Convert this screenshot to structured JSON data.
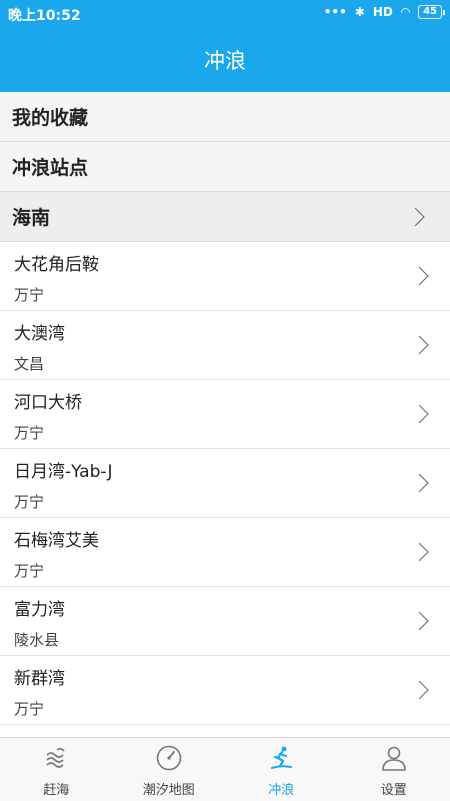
{
  "status_bar": {
    "time": "晚上10:52",
    "dots": "•••",
    "bluetooth": "✱",
    "signal": "HD",
    "wifi": "◠",
    "battery": "45"
  },
  "header": {
    "title": "冲浪"
  },
  "menu": {
    "favorites": "我的收藏",
    "surf_spots": "冲浪站点"
  },
  "region": {
    "name": "海南"
  },
  "spots": [
    {
      "name": "大花角后鞍",
      "location": "万宁"
    },
    {
      "name": "大澳湾",
      "location": "文昌"
    },
    {
      "name": "河口大桥",
      "location": "万宁"
    },
    {
      "name": "日月湾-Yab-J",
      "location": "万宁"
    },
    {
      "name": "石梅湾艾美",
      "location": "万宁"
    },
    {
      "name": "富力湾",
      "location": "陵水县"
    },
    {
      "name": "新群湾",
      "location": "万宁"
    }
  ],
  "tabs": [
    {
      "label": "赶海",
      "icon": "waves-icon",
      "active": false
    },
    {
      "label": "潮汐地图",
      "icon": "gauge-icon",
      "active": false
    },
    {
      "label": "冲浪",
      "icon": "surfer-icon",
      "active": true
    },
    {
      "label": "设置",
      "icon": "user-icon",
      "active": false
    }
  ],
  "colors": {
    "primary": "#1aa7ec"
  }
}
